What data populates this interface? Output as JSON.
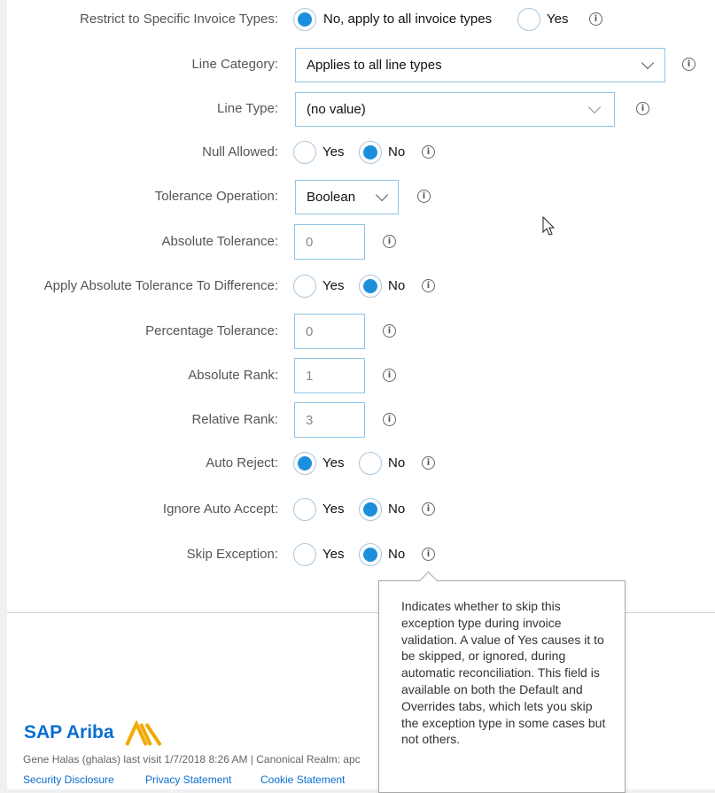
{
  "form": {
    "restrict_invoice_types": {
      "label": "Restrict to Specific Invoice Types:",
      "options": [
        {
          "label": "No, apply to all invoice types",
          "selected": true
        },
        {
          "label": "Yes",
          "selected": false
        }
      ]
    },
    "line_category": {
      "label": "Line Category:",
      "value": "Applies to all line types"
    },
    "line_type": {
      "label": "Line Type:",
      "value": "(no value)"
    },
    "null_allowed": {
      "label": "Null Allowed:",
      "options": [
        {
          "label": "Yes",
          "selected": false
        },
        {
          "label": "No",
          "selected": true
        }
      ]
    },
    "tolerance_operation": {
      "label": "Tolerance Operation:",
      "value": "Boolean"
    },
    "absolute_tolerance": {
      "label": "Absolute Tolerance:",
      "value": "0"
    },
    "apply_abs_tol_diff": {
      "label": "Apply Absolute Tolerance To Difference:",
      "options": [
        {
          "label": "Yes",
          "selected": false
        },
        {
          "label": "No",
          "selected": true
        }
      ]
    },
    "percentage_tolerance": {
      "label": "Percentage Tolerance:",
      "value": "0"
    },
    "absolute_rank": {
      "label": "Absolute Rank:",
      "value": "1"
    },
    "relative_rank": {
      "label": "Relative Rank:",
      "value": "3"
    },
    "auto_reject": {
      "label": "Auto Reject:",
      "options": [
        {
          "label": "Yes",
          "selected": true
        },
        {
          "label": "No",
          "selected": false
        }
      ]
    },
    "ignore_auto_accept": {
      "label": "Ignore Auto Accept:",
      "options": [
        {
          "label": "Yes",
          "selected": false
        },
        {
          "label": "No",
          "selected": true
        }
      ]
    },
    "skip_exception": {
      "label": "Skip Exception:",
      "options": [
        {
          "label": "Yes",
          "selected": false
        },
        {
          "label": "No",
          "selected": true
        }
      ]
    }
  },
  "tooltip": {
    "text": "Indicates whether to skip this exception type during invoice validation. A value of Yes causes it to be skipped, or ignored, during automatic reconciliation. This field is available on both the Default and Overrides tabs, which lets you skip the exception type in some cases but not others."
  },
  "footer": {
    "logo_text": "SAP Ariba",
    "user_line": "Gene Halas (ghalas) last visit 1/7/2018 8:26 AM | Canonical Realm: apc",
    "links": [
      "Security Disclosure",
      "Privacy Statement",
      "Cookie Statement"
    ]
  },
  "icons": {
    "info": "info-icon",
    "dropdown": "chevron-down-icon",
    "cursor": "mouse-pointer-icon"
  },
  "colors": {
    "accent": "#1c8fdc",
    "brand": "#0a6ed1",
    "border": "#8fc3e6"
  }
}
